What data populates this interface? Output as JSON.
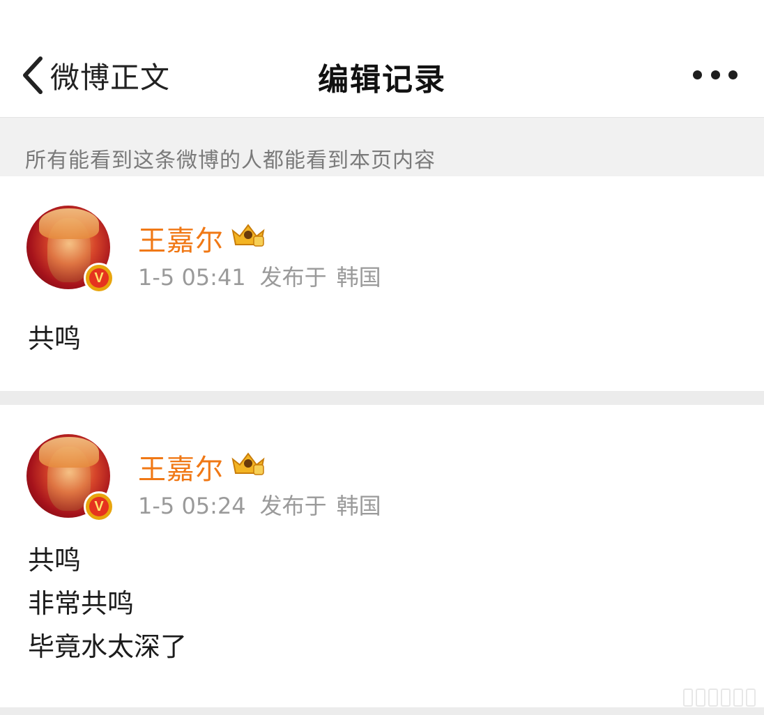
{
  "header": {
    "back_label": "微博正文",
    "title": "编辑记录"
  },
  "notice": "所有能看到这条微博的人都能看到本页内容",
  "records": [
    {
      "username": "王嘉尔",
      "time": "1-5 05:41",
      "published_label": "发布于",
      "location": "韩国",
      "content_lines": [
        "共鸣"
      ]
    },
    {
      "username": "王嘉尔",
      "time": "1-5 05:24",
      "published_label": "发布于",
      "location": "韩国",
      "content_lines": [
        "共鸣",
        "非常共鸣",
        "毕竟水太深了"
      ]
    }
  ],
  "colors": {
    "username": "#f07815",
    "meta": "#9a9a9a",
    "notice_bg": "#f1f1f1"
  },
  "icons": {
    "back": "chevron-left-icon",
    "more": "more-dots-icon",
    "verified": "verified-v-icon",
    "member": "crown-member-icon"
  }
}
